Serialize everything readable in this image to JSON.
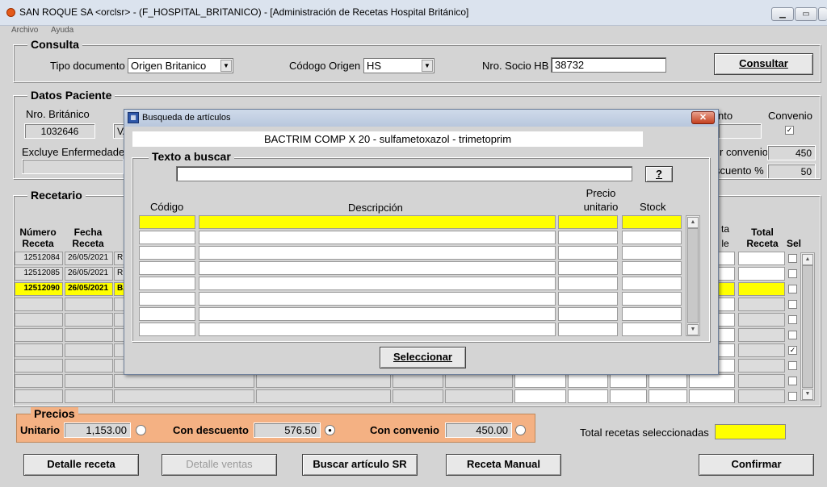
{
  "window": {
    "title": "SAN ROQUE SA <orclsr> - (F_HOSPITAL_BRITANICO) - [Administración de Recetas Hospital Británico]",
    "menu": [
      "Archivo",
      "Ayuda"
    ]
  },
  "consulta": {
    "title": "Consulta",
    "tipo_documento_label": "Tipo documento",
    "tipo_documento_value": "Origen Britanico",
    "codigo_origen_label": "Códogo Origen",
    "codigo_origen_value": "HS",
    "nro_socio_label": "Nro. Socio HB",
    "nro_socio_value": "38732",
    "consultar_label": "Consultar"
  },
  "datos_paciente": {
    "title": "Datos Paciente",
    "nro_britanico_label": "Nro. Británico",
    "nro_britanico_value": "1032646",
    "nombre_partial": "VA",
    "excluye_label": "Excluye Enfermedade",
    "convenio_label": "Convenio",
    "convenio_checked": "✓",
    "descuento_partial_label": "nto",
    "por_convenio_label": "r convenio",
    "por_convenio_value": "450",
    "descuento_label": "scuento %",
    "descuento_value": "50"
  },
  "recetario": {
    "title": "Recetario",
    "col_numero": "Número Receta",
    "col_fecha": "Fecha Receta",
    "col_partial": "ta",
    "col_partial2": "le",
    "col_total": "Total Receta",
    "col_sel": "Sel",
    "rows": [
      {
        "numero": "12512084",
        "fecha": "26/05/2021",
        "desc": "RIV"
      },
      {
        "numero": "12512085",
        "fecha": "26/05/2021",
        "desc": "RIV"
      },
      {
        "numero": "12512090",
        "fecha": "26/05/2021",
        "desc": "BA"
      }
    ]
  },
  "precios": {
    "title": "Precios",
    "unitario_label": "Unitario",
    "unitario_value": "1,153.00",
    "con_descuento_label": "Con descuento",
    "con_descuento_value": "576.50",
    "con_convenio_label": "Con convenio",
    "con_convenio_value": "450.00",
    "total_sel_label": "Total recetas seleccionadas",
    "total_sel_value": ""
  },
  "buttons": {
    "detalle_receta": "Detalle receta",
    "detalle_ventas": "Detalle ventas",
    "buscar_articulo": "Buscar artículo SR",
    "receta_manual": "Receta Manual",
    "confirmar": "Confirmar"
  },
  "dialog": {
    "title": "Busqueda de artículos",
    "product": "BACTRIM COMP X 20 - sulfametoxazol - trimetoprim",
    "texto_buscar_label": "Texto a buscar",
    "texto_buscar_value": "",
    "help_label": "?",
    "col_codigo": "Código",
    "col_descripcion": "Descripción",
    "col_precio": "Precio unitario",
    "col_stock": "Stock",
    "seleccionar_label": "Seleccionar"
  }
}
